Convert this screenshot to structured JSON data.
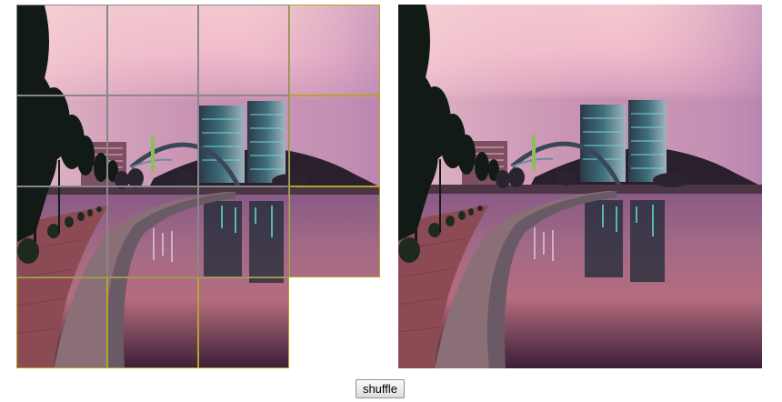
{
  "game": {
    "grid": {
      "rows": 4,
      "cols": 4
    },
    "empty_tile": 15,
    "tiles": [
      {
        "piece": 0,
        "outline": "#888888"
      },
      {
        "piece": 1,
        "outline": "#888888"
      },
      {
        "piece": 2,
        "outline": "#888888"
      },
      {
        "piece": 3,
        "outline": "#b4a42a"
      },
      {
        "piece": 4,
        "outline": "#888888"
      },
      {
        "piece": 5,
        "outline": "#888888"
      },
      {
        "piece": 6,
        "outline": "#888888"
      },
      {
        "piece": 7,
        "outline": "#b4a42a"
      },
      {
        "piece": 8,
        "outline": "#888888"
      },
      {
        "piece": 9,
        "outline": "#888888"
      },
      {
        "piece": 10,
        "outline": "#888888"
      },
      {
        "piece": 11,
        "outline": "#b4a42a"
      },
      {
        "piece": 12,
        "outline": "#b4a42a"
      },
      {
        "piece": 13,
        "outline": "#b4a42a"
      },
      {
        "piece": 14,
        "outline": "#b4a42a"
      }
    ]
  },
  "controls": {
    "shuffle_label": "shuffle"
  }
}
